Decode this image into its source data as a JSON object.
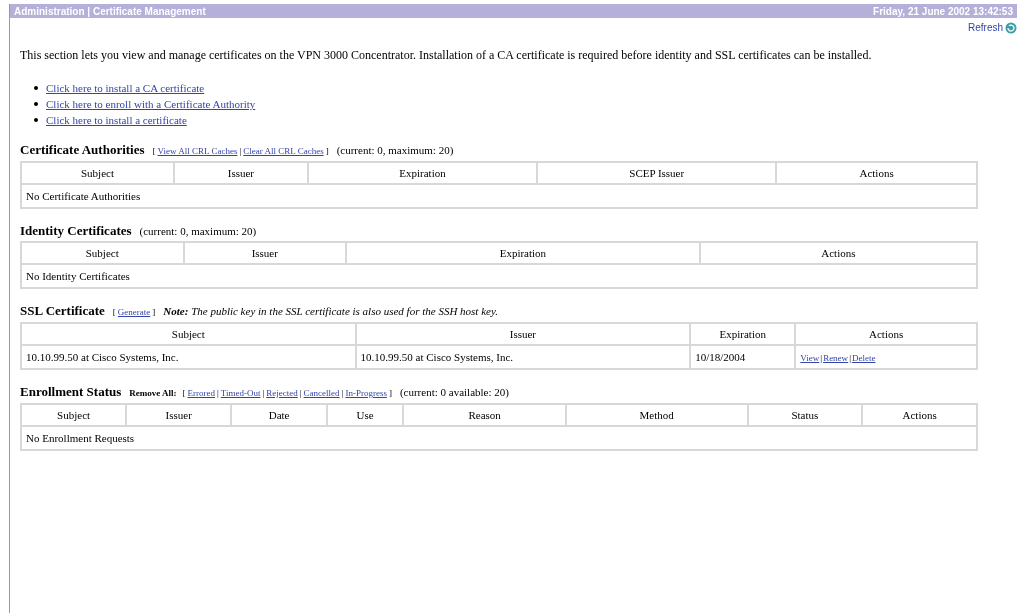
{
  "header": {
    "title": "Administration | Certificate Management",
    "datetime": "Friday, 21 June 2002 13:42:53"
  },
  "refresh": {
    "label": "Refresh"
  },
  "intro": "This section lets you view and manage certificates on the VPN 3000 Concentrator. Installation of a CA certificate is required before identity and SSL certificates can be installed.",
  "links": [
    "Click here to install a CA certificate",
    "Click here to enroll with a Certificate Authority",
    "Click here to install a certificate"
  ],
  "sections": [
    {
      "title": "Certificate Authorities",
      "link_group": {
        "open": "[",
        "links": [
          "View All CRL Caches",
          "Clear All CRL Caches"
        ],
        "separator": "|",
        "close": "]"
      },
      "count": "(current: 0, maximum: 20)",
      "table": {
        "columns": [
          "Subject",
          "Issuer",
          "Expiration",
          "SCEP Issuer",
          "Actions"
        ],
        "empty": "No Certificate Authorities"
      }
    },
    {
      "title": "Identity Certificates",
      "count": "(current: 0, maximum: 20)",
      "table": {
        "columns": [
          "Subject",
          "Issuer",
          "Expiration",
          "Actions"
        ],
        "empty": "No Identity Certificates"
      }
    },
    {
      "title": "SSL Certificate",
      "link_group": {
        "open": "[",
        "links": [
          "Generate"
        ],
        "separator": "|",
        "close": "]"
      },
      "note": "**Note:** The public key in the SSL certificate is also used for the SSH host key.",
      "table": {
        "columns": [
          "Subject",
          "Issuer",
          "Expiration",
          "Actions"
        ],
        "rows": [
          {
            "cells": [
              "10.10.99.50 at Cisco Systems, Inc.",
              "10.10.99.50 at Cisco Systems, Inc.",
              "10/18/2004"
            ],
            "actions": [
              "View",
              "Renew",
              "Delete"
            ]
          }
        ]
      }
    },
    {
      "title": "Enrollment Status",
      "link_group": {
        "prefix": "Remove All:",
        "open": "[",
        "links": [
          "Errored",
          "Timed-Out",
          "Rejected",
          "Cancelled",
          "In-Progress"
        ],
        "separator": "|",
        "close": "]"
      },
      "count": "(current: 0 available: 20)",
      "table": {
        "columns": [
          "Subject",
          "Issuer",
          "Date",
          "Use",
          "Reason",
          "Method",
          "Status",
          "Actions"
        ],
        "empty": "No Enrollment Requests"
      }
    }
  ]
}
